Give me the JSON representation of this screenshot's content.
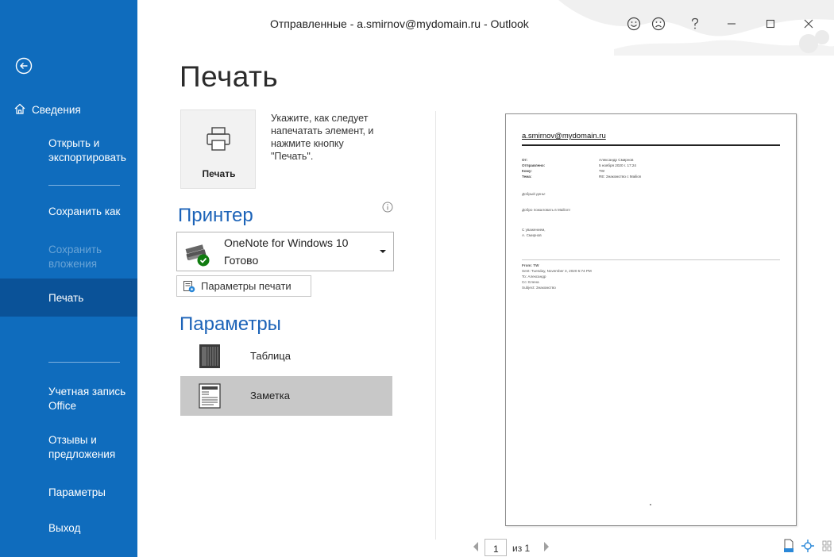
{
  "window": {
    "title": "Отправленные - a.smirnov@mydomain.ru - Outlook"
  },
  "colors": {
    "sidebar_bg": "#0f6cbd",
    "sidebar_active": "#0a5298",
    "accent_heading": "#1c63b8",
    "selected_style": "#c8c8c8"
  },
  "sidebar": {
    "back_icon": "arrow-left-circle-icon",
    "items": [
      {
        "label": "Сведения",
        "icon": "home-icon"
      },
      {
        "label_l1": "Открыть и",
        "label_l2": "экспортировать"
      },
      {
        "label": "Сохранить как"
      },
      {
        "label_l1": "Сохранить",
        "label_l2": "вложения",
        "disabled": true
      },
      {
        "label": "Печать",
        "active": true
      },
      {
        "label_l1": "Учетная запись",
        "label_l2": "Office"
      },
      {
        "label_l1": "Отзывы и",
        "label_l2": "предложения"
      },
      {
        "label": "Параметры"
      },
      {
        "label": "Выход"
      }
    ]
  },
  "page": {
    "title": "Печать"
  },
  "print": {
    "button_label": "Печать",
    "description_lines": [
      "Укажите, как следует",
      "напечатать элемент, и",
      "нажмите кнопку",
      "\"Печать\"."
    ]
  },
  "printer": {
    "heading": "Принтер",
    "name": "OneNote for Windows 10",
    "status": "Готово",
    "options_button": "Параметры печати"
  },
  "settings": {
    "heading": "Параметры",
    "styles": [
      {
        "label": "Таблица",
        "icon": "table-style-icon",
        "selected": false
      },
      {
        "label": "Заметка",
        "icon": "memo-style-icon",
        "selected": true
      }
    ]
  },
  "preview": {
    "email": "a.smirnov@mydomain.ru",
    "header_rows": [
      {
        "key": "От:",
        "value": "Александр Смирнов"
      },
      {
        "key": "Отправлено:",
        "value": "5 ноября 2020 г. 17:24"
      },
      {
        "key": "Кому:",
        "value": "TW"
      },
      {
        "key": "Тема:",
        "value": "RE: Знакомство с Mailion"
      }
    ],
    "body_lines": [
      "Добрый день!",
      "Добро пожаловать в Mailion!",
      "С уважением,",
      "А. Смирнов"
    ],
    "quoted_lines": [
      "From: TW",
      "Sent: Tuesday, November 3, 2020 5:74 PM",
      "To: Александр",
      "Cc: Елена",
      "Subject: Знакомство"
    ]
  },
  "pager": {
    "current_page": "1",
    "of_text": "из 1"
  }
}
